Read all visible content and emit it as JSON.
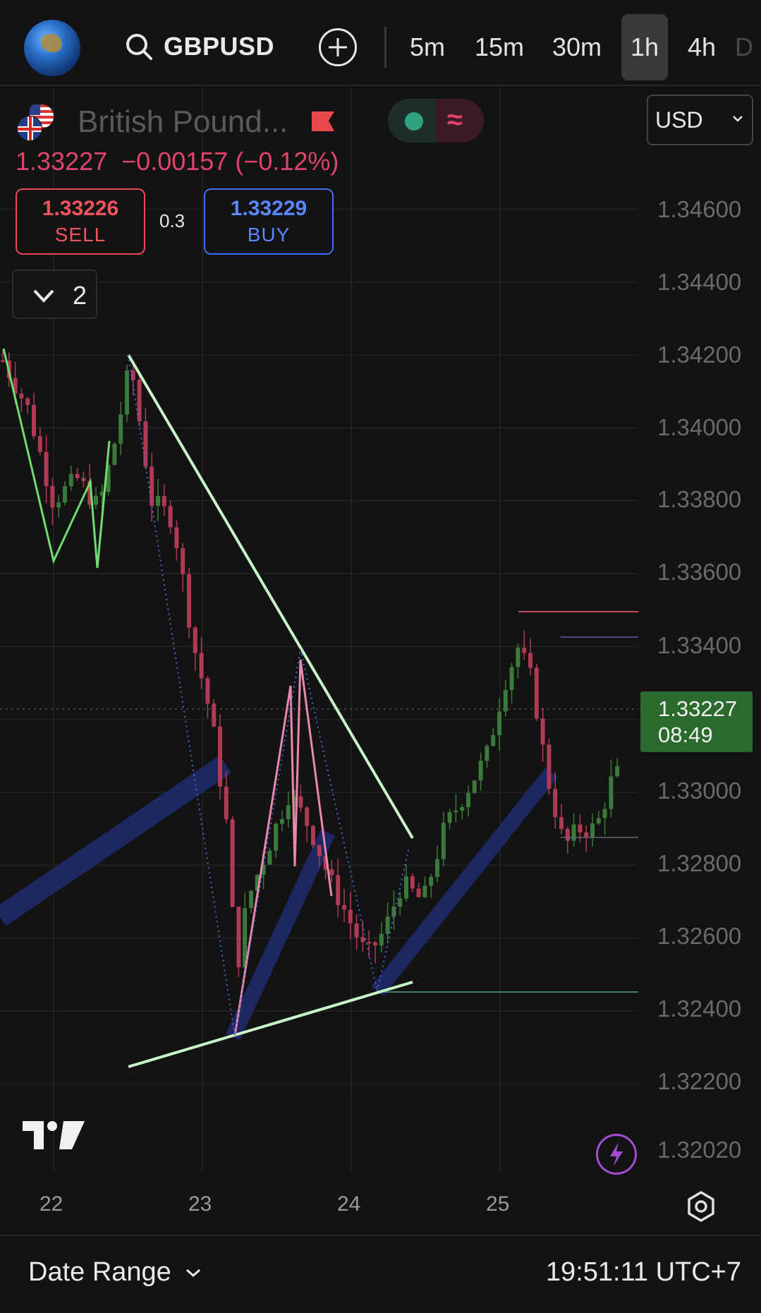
{
  "toolbar": {
    "symbol": "GBPUSD",
    "timeframes": [
      {
        "label": "5m",
        "active": false
      },
      {
        "label": "15m",
        "active": false
      },
      {
        "label": "30m",
        "active": false
      },
      {
        "label": "1h",
        "active": true
      },
      {
        "label": "4h",
        "active": false
      },
      {
        "label": "D",
        "active": false
      }
    ]
  },
  "legend": {
    "name": "British Pound...",
    "price": "1.33227",
    "change": "−0.00157 (−0.12%)",
    "sell_price": "1.33226",
    "sell_label": "SELL",
    "buy_price": "1.33229",
    "buy_label": "BUY",
    "spread": "0.3",
    "indicators_count": "2",
    "currency": "USD"
  },
  "colors": {
    "up": "#3a7a3a",
    "down": "#b03a55",
    "last_price_bg": "#2a6a2c",
    "trendline": "#c8f5c8",
    "channel": "#1f2a6a",
    "zigzag_pink": "#e888aa",
    "zigzag_green": "#6fdd6f"
  },
  "price_axis": {
    "ticks": [
      "1.34600",
      "1.34400",
      "1.34200",
      "1.34000",
      "1.33800",
      "1.33600",
      "1.33400",
      "1.33000",
      "1.32800",
      "1.32600",
      "1.32400",
      "1.32200",
      "1.32020"
    ],
    "last_price": "1.33227",
    "countdown": "08:49"
  },
  "time_axis": {
    "ticks": [
      "22",
      "23",
      "24",
      "25"
    ]
  },
  "bottom": {
    "date_range_label": "Date Range",
    "clock": "19:51:11 UTC+7"
  }
}
